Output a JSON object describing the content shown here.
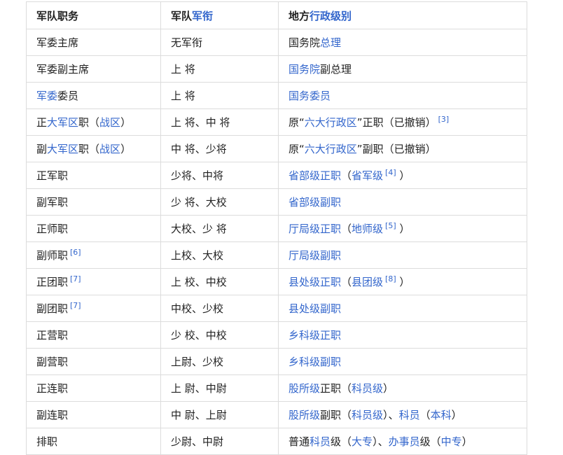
{
  "colors": {
    "link": "#3366cc",
    "text": "#222222",
    "border": "#dcdcdc"
  },
  "headers": [
    [
      {
        "t": "军队职务"
      }
    ],
    [
      {
        "t": "军队"
      },
      {
        "t": "军衔",
        "link": true
      }
    ],
    [
      {
        "t": "地方"
      },
      {
        "t": "行政级别",
        "link": true
      }
    ]
  ],
  "rows": [
    [
      [
        {
          "t": "军委主席"
        }
      ],
      [
        {
          "t": "无军衔"
        }
      ],
      [
        {
          "t": "国务院"
        },
        {
          "t": "总理",
          "link": true
        }
      ]
    ],
    [
      [
        {
          "t": "军委副主席"
        }
      ],
      [
        {
          "t": "上 将"
        }
      ],
      [
        {
          "t": "国务院",
          "link": true
        },
        {
          "t": "副总理"
        }
      ]
    ],
    [
      [
        {
          "t": "军委",
          "link": true
        },
        {
          "t": "委员"
        }
      ],
      [
        {
          "t": "上 将"
        }
      ],
      [
        {
          "t": "国务委员",
          "link": true
        }
      ]
    ],
    [
      [
        {
          "t": "正"
        },
        {
          "t": "大军区",
          "link": true
        },
        {
          "t": "职（"
        },
        {
          "t": "战区",
          "link": true
        },
        {
          "t": "）"
        }
      ],
      [
        {
          "t": "上 将、中 将"
        }
      ],
      [
        {
          "t": "原“"
        },
        {
          "t": "六大行政区",
          "link": true
        },
        {
          "t": "”正职（已撤销）"
        },
        {
          "t": "[3]",
          "sup": true
        }
      ]
    ],
    [
      [
        {
          "t": "副"
        },
        {
          "t": "大军区",
          "link": true
        },
        {
          "t": "职（"
        },
        {
          "t": "战区",
          "link": true
        },
        {
          "t": "）"
        }
      ],
      [
        {
          "t": "中 将、少将"
        }
      ],
      [
        {
          "t": "原“"
        },
        {
          "t": "六大行政区",
          "link": true
        },
        {
          "t": "”副职（已撤销）"
        }
      ]
    ],
    [
      [
        {
          "t": "正军职"
        }
      ],
      [
        {
          "t": "少将、中将"
        }
      ],
      [
        {
          "t": "省部级正职",
          "link": true
        },
        {
          "t": "（"
        },
        {
          "t": "省军级",
          "link": true
        },
        {
          "t": "[4]",
          "sup": true
        },
        {
          "t": " ）"
        }
      ]
    ],
    [
      [
        {
          "t": "副军职"
        }
      ],
      [
        {
          "t": "少 将、大校"
        }
      ],
      [
        {
          "t": "省部级副职",
          "link": true
        }
      ]
    ],
    [
      [
        {
          "t": "正师职"
        }
      ],
      [
        {
          "t": "大校、少 将"
        }
      ],
      [
        {
          "t": "厅局级正职",
          "link": true
        },
        {
          "t": "（"
        },
        {
          "t": "地师级",
          "link": true
        },
        {
          "t": "[5]",
          "sup": true
        },
        {
          "t": " ）"
        }
      ]
    ],
    [
      [
        {
          "t": "副师职"
        },
        {
          "t": "[6]",
          "sup": true
        }
      ],
      [
        {
          "t": "上校、大校"
        }
      ],
      [
        {
          "t": "厅局级副职",
          "link": true
        }
      ]
    ],
    [
      [
        {
          "t": "正团职"
        },
        {
          "t": "[7]",
          "sup": true
        }
      ],
      [
        {
          "t": "上 校、中校"
        }
      ],
      [
        {
          "t": "县处级正职",
          "link": true
        },
        {
          "t": "（"
        },
        {
          "t": "县团级",
          "link": true
        },
        {
          "t": "[8]",
          "sup": true
        },
        {
          "t": " ）"
        }
      ]
    ],
    [
      [
        {
          "t": "副团职"
        },
        {
          "t": "[7]",
          "sup": true
        }
      ],
      [
        {
          "t": "中校、少校"
        }
      ],
      [
        {
          "t": "县处级副职",
          "link": true
        }
      ]
    ],
    [
      [
        {
          "t": "正营职"
        }
      ],
      [
        {
          "t": "少 校、中校"
        }
      ],
      [
        {
          "t": "乡科级正职",
          "link": true
        }
      ]
    ],
    [
      [
        {
          "t": "副营职"
        }
      ],
      [
        {
          "t": "上尉、少校"
        }
      ],
      [
        {
          "t": "乡科级副职",
          "link": true
        }
      ]
    ],
    [
      [
        {
          "t": "正连职"
        }
      ],
      [
        {
          "t": "上 尉、中尉"
        }
      ],
      [
        {
          "t": "股所级",
          "link": true
        },
        {
          "t": "正职（"
        },
        {
          "t": "科员级",
          "link": true
        },
        {
          "t": "）"
        }
      ]
    ],
    [
      [
        {
          "t": "副连职"
        }
      ],
      [
        {
          "t": "中 尉、上尉"
        }
      ],
      [
        {
          "t": "股所级",
          "link": true
        },
        {
          "t": "副职（"
        },
        {
          "t": "科员级",
          "link": true
        },
        {
          "t": "）、"
        },
        {
          "t": "科员",
          "link": true
        },
        {
          "t": "（"
        },
        {
          "t": "本科",
          "link": true
        },
        {
          "t": "）"
        }
      ]
    ],
    [
      [
        {
          "t": "排职"
        }
      ],
      [
        {
          "t": "少尉、中尉"
        }
      ],
      [
        {
          "t": "普通"
        },
        {
          "t": "科员",
          "link": true
        },
        {
          "t": "级（"
        },
        {
          "t": "大专",
          "link": true
        },
        {
          "t": "）、"
        },
        {
          "t": "办事员",
          "link": true
        },
        {
          "t": "级（"
        },
        {
          "t": "中专",
          "link": true
        },
        {
          "t": "）"
        }
      ]
    ]
  ]
}
